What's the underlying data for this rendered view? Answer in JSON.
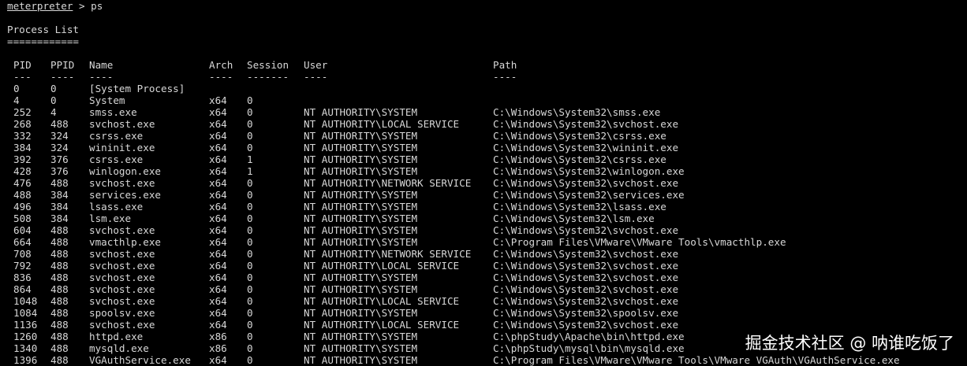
{
  "prompt": {
    "name": "meterpreter",
    "separator": " > ",
    "command": "ps"
  },
  "title": "Process List",
  "title_underline": "============",
  "columns": {
    "pid": "PID",
    "ppid": "PPID",
    "name": "Name",
    "arch": "Arch",
    "session": "Session",
    "user": "User",
    "path": "Path"
  },
  "underlines": {
    "pid": "---",
    "ppid": "----",
    "name": "----",
    "arch": "----",
    "session": "-------",
    "user": "----",
    "path": "----"
  },
  "processes": [
    {
      "pid": "0",
      "ppid": "0",
      "name": "[System Process]",
      "arch": "",
      "session": "",
      "user": "",
      "path": ""
    },
    {
      "pid": "4",
      "ppid": "0",
      "name": "System",
      "arch": "x64",
      "session": "0",
      "user": "",
      "path": ""
    },
    {
      "pid": "252",
      "ppid": "4",
      "name": "smss.exe",
      "arch": "x64",
      "session": "0",
      "user": "NT AUTHORITY\\SYSTEM",
      "path": "C:\\Windows\\System32\\smss.exe"
    },
    {
      "pid": "268",
      "ppid": "488",
      "name": "svchost.exe",
      "arch": "x64",
      "session": "0",
      "user": "NT AUTHORITY\\LOCAL SERVICE",
      "path": "C:\\Windows\\System32\\svchost.exe"
    },
    {
      "pid": "332",
      "ppid": "324",
      "name": "csrss.exe",
      "arch": "x64",
      "session": "0",
      "user": "NT AUTHORITY\\SYSTEM",
      "path": "C:\\Windows\\System32\\csrss.exe"
    },
    {
      "pid": "384",
      "ppid": "324",
      "name": "wininit.exe",
      "arch": "x64",
      "session": "0",
      "user": "NT AUTHORITY\\SYSTEM",
      "path": "C:\\Windows\\System32\\wininit.exe"
    },
    {
      "pid": "392",
      "ppid": "376",
      "name": "csrss.exe",
      "arch": "x64",
      "session": "1",
      "user": "NT AUTHORITY\\SYSTEM",
      "path": "C:\\Windows\\System32\\csrss.exe"
    },
    {
      "pid": "428",
      "ppid": "376",
      "name": "winlogon.exe",
      "arch": "x64",
      "session": "1",
      "user": "NT AUTHORITY\\SYSTEM",
      "path": "C:\\Windows\\System32\\winlogon.exe"
    },
    {
      "pid": "476",
      "ppid": "488",
      "name": "svchost.exe",
      "arch": "x64",
      "session": "0",
      "user": "NT AUTHORITY\\NETWORK SERVICE",
      "path": "C:\\Windows\\System32\\svchost.exe"
    },
    {
      "pid": "488",
      "ppid": "384",
      "name": "services.exe",
      "arch": "x64",
      "session": "0",
      "user": "NT AUTHORITY\\SYSTEM",
      "path": "C:\\Windows\\System32\\services.exe"
    },
    {
      "pid": "496",
      "ppid": "384",
      "name": "lsass.exe",
      "arch": "x64",
      "session": "0",
      "user": "NT AUTHORITY\\SYSTEM",
      "path": "C:\\Windows\\System32\\lsass.exe"
    },
    {
      "pid": "508",
      "ppid": "384",
      "name": "lsm.exe",
      "arch": "x64",
      "session": "0",
      "user": "NT AUTHORITY\\SYSTEM",
      "path": "C:\\Windows\\System32\\lsm.exe"
    },
    {
      "pid": "604",
      "ppid": "488",
      "name": "svchost.exe",
      "arch": "x64",
      "session": "0",
      "user": "NT AUTHORITY\\SYSTEM",
      "path": "C:\\Windows\\System32\\svchost.exe"
    },
    {
      "pid": "664",
      "ppid": "488",
      "name": "vmacthlp.exe",
      "arch": "x64",
      "session": "0",
      "user": "NT AUTHORITY\\SYSTEM",
      "path": "C:\\Program Files\\VMware\\VMware Tools\\vmacthlp.exe"
    },
    {
      "pid": "708",
      "ppid": "488",
      "name": "svchost.exe",
      "arch": "x64",
      "session": "0",
      "user": "NT AUTHORITY\\NETWORK SERVICE",
      "path": "C:\\Windows\\System32\\svchost.exe"
    },
    {
      "pid": "792",
      "ppid": "488",
      "name": "svchost.exe",
      "arch": "x64",
      "session": "0",
      "user": "NT AUTHORITY\\LOCAL SERVICE",
      "path": "C:\\Windows\\System32\\svchost.exe"
    },
    {
      "pid": "836",
      "ppid": "488",
      "name": "svchost.exe",
      "arch": "x64",
      "session": "0",
      "user": "NT AUTHORITY\\SYSTEM",
      "path": "C:\\Windows\\System32\\svchost.exe"
    },
    {
      "pid": "864",
      "ppid": "488",
      "name": "svchost.exe",
      "arch": "x64",
      "session": "0",
      "user": "NT AUTHORITY\\SYSTEM",
      "path": "C:\\Windows\\System32\\svchost.exe"
    },
    {
      "pid": "1048",
      "ppid": "488",
      "name": "svchost.exe",
      "arch": "x64",
      "session": "0",
      "user": "NT AUTHORITY\\LOCAL SERVICE",
      "path": "C:\\Windows\\System32\\svchost.exe"
    },
    {
      "pid": "1084",
      "ppid": "488",
      "name": "spoolsv.exe",
      "arch": "x64",
      "session": "0",
      "user": "NT AUTHORITY\\SYSTEM",
      "path": "C:\\Windows\\System32\\spoolsv.exe"
    },
    {
      "pid": "1136",
      "ppid": "488",
      "name": "svchost.exe",
      "arch": "x64",
      "session": "0",
      "user": "NT AUTHORITY\\LOCAL SERVICE",
      "path": "C:\\Windows\\System32\\svchost.exe"
    },
    {
      "pid": "1260",
      "ppid": "488",
      "name": "httpd.exe",
      "arch": "x86",
      "session": "0",
      "user": "NT AUTHORITY\\SYSTEM",
      "path": "C:\\phpStudy\\Apache\\bin\\httpd.exe"
    },
    {
      "pid": "1340",
      "ppid": "488",
      "name": "mysqld.exe",
      "arch": "x86",
      "session": "0",
      "user": "NT AUTHORITY\\SYSTEM",
      "path": "C:\\phpStudy\\mysql\\bin\\mysqld.exe"
    },
    {
      "pid": "1396",
      "ppid": "488",
      "name": "VGAuthService.exe",
      "arch": "x64",
      "session": "0",
      "user": "NT AUTHORITY\\SYSTEM",
      "path": "C:\\Program Files\\VMware\\VMware Tools\\VMware VGAuth\\VGAuthService.exe"
    }
  ],
  "watermark": "掘金技术社区 @ 呐谁吃饭了",
  "colors": {
    "background": "#000000",
    "text": "#d8d8d8",
    "watermark": "#ffffff"
  }
}
